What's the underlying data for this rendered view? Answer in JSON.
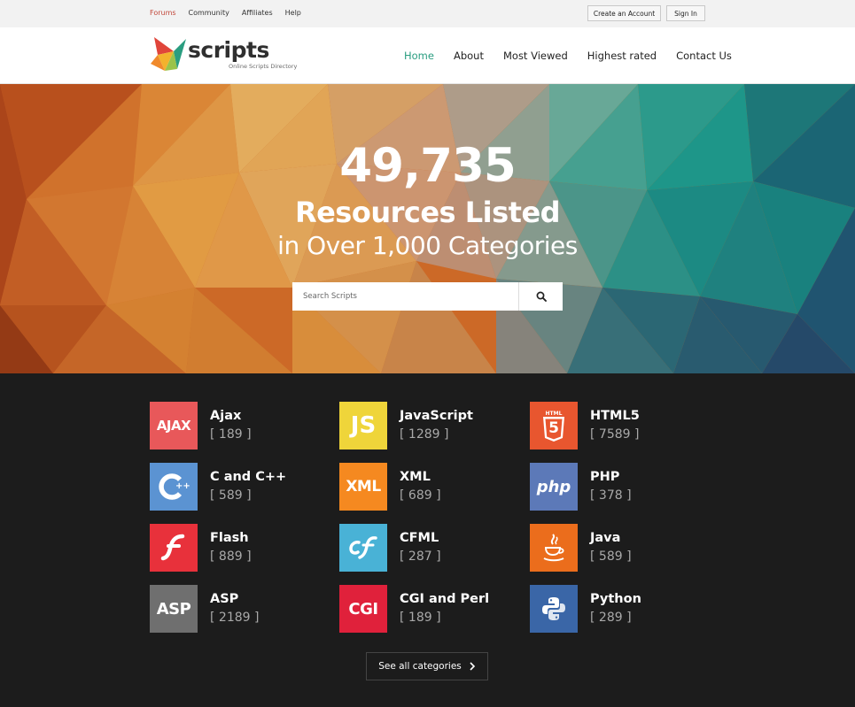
{
  "topbar": {
    "links": [
      "Forums",
      "Community",
      "Affiliates",
      "Help"
    ],
    "create_account": "Create an Account",
    "sign_in": "Sign In"
  },
  "header": {
    "logo_text": "scripts",
    "logo_tagline": "Online Scripts Directory",
    "nav": [
      "Home",
      "About",
      "Most Viewed",
      "Highest rated",
      "Contact Us"
    ]
  },
  "hero": {
    "count": "49,735",
    "line1": "Resources Listed",
    "line2": "in Over 1,000 Categories",
    "search_placeholder": "Search Scripts"
  },
  "categories": [
    {
      "name": "Ajax",
      "count": "[ 189 ]",
      "icon": "ajax-icon",
      "color": "#e8585a"
    },
    {
      "name": "JavaScript",
      "count": "[ 1289 ]",
      "icon": "javascript-icon",
      "color": "#efd53a"
    },
    {
      "name": "HTML5",
      "count": "[ 7589 ]",
      "icon": "html5-icon",
      "color": "#e8562f"
    },
    {
      "name": "C and C++",
      "count": "[ 589 ]",
      "icon": "cplusplus-icon",
      "color": "#5b93d2"
    },
    {
      "name": "XML",
      "count": "[ 689 ]",
      "icon": "xml-icon",
      "color": "#f58920"
    },
    {
      "name": "PHP",
      "count": "[ 378 ]",
      "icon": "php-icon",
      "color": "#5c79b8"
    },
    {
      "name": "Flash",
      "count": "[ 889 ]",
      "icon": "flash-icon",
      "color": "#e8313b"
    },
    {
      "name": "CFML",
      "count": "[ 287 ]",
      "icon": "cfml-icon",
      "color": "#49b2d6"
    },
    {
      "name": "Java",
      "count": "[ 589 ]",
      "icon": "java-icon",
      "color": "#eb6d1c"
    },
    {
      "name": "ASP",
      "count": "[ 2189 ]",
      "icon": "asp-icon",
      "color": "#6f6f6f"
    },
    {
      "name": "CGI and Perl",
      "count": "[ 189 ]",
      "icon": "cgi-icon",
      "color": "#e0213b"
    },
    {
      "name": "Python",
      "count": "[ 289 ]",
      "icon": "python-icon",
      "color": "#3a66a7"
    }
  ],
  "tile_text": {
    "ajax": "AJAX",
    "javascript": "JS",
    "html5_word": "HTML",
    "html5_num": "5",
    "cpp": "++",
    "xml": "XML",
    "php": "php",
    "asp": "ASP",
    "cgi": "CGI"
  },
  "see_all": "See all categories",
  "colors": {
    "accent": "#2a9d80",
    "topbar_active": "#c2473a",
    "dark_bg": "#1c1c1c"
  }
}
